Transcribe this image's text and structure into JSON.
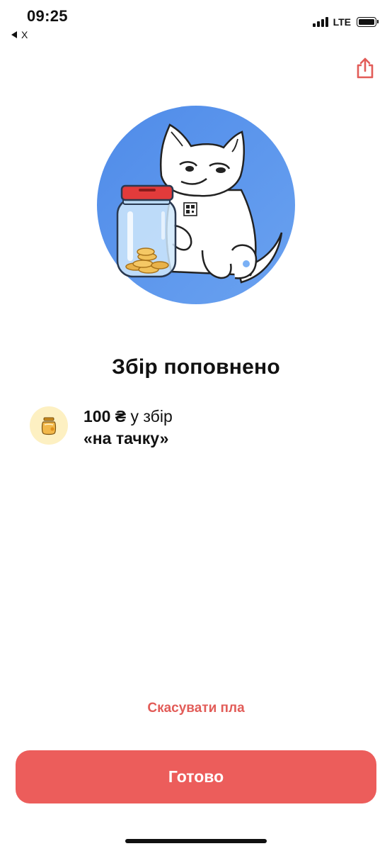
{
  "status_bar": {
    "time": "09:25",
    "back_label": "X",
    "network": "LTE"
  },
  "header": {
    "share_icon": "share-icon"
  },
  "illustration": {
    "description_icon": "cat-with-jar-illustration"
  },
  "main": {
    "title": "Збір поповнено",
    "amount": "100 ₴",
    "amount_suffix": " у збір",
    "jar_name": "«на тачку»",
    "jar_icon": "jar-icon"
  },
  "actions": {
    "cancel_label": "Скасувати пла",
    "done_label": "Готово"
  },
  "colors": {
    "accent": "#ec5d5b",
    "cancel_text": "#e25c58",
    "circle": "#5a93ec",
    "badge_bg": "#fdf0c2"
  }
}
